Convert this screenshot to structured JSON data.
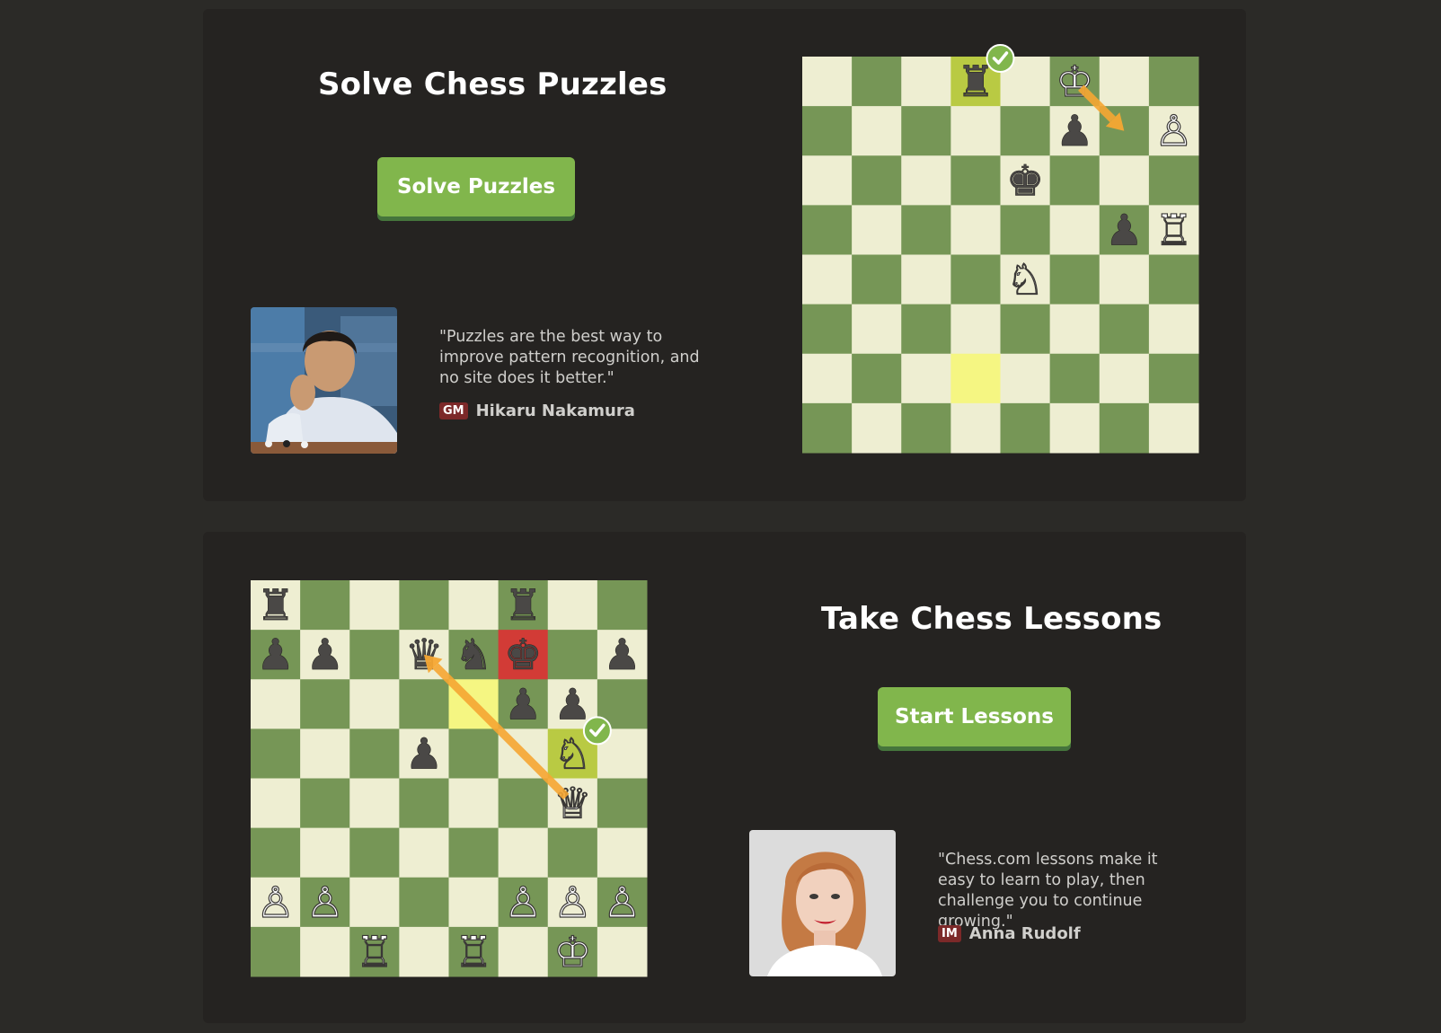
{
  "puzzles_section": {
    "title": "Solve Chess Puzzles",
    "button_label": "Solve Puzzles",
    "quote": "\"Puzzles are the best way to improve pattern recognition, and no site does it better.\"",
    "author_title": "GM",
    "author_name": "Hikaru Nakamura",
    "board": {
      "pieces": [
        {
          "square": "d8",
          "piece": "rook",
          "color": "black"
        },
        {
          "square": "f8",
          "piece": "king",
          "color": "white"
        },
        {
          "square": "f7",
          "piece": "pawn",
          "color": "black"
        },
        {
          "square": "h7",
          "piece": "pawn",
          "color": "white"
        },
        {
          "square": "e6",
          "piece": "king",
          "color": "black"
        },
        {
          "square": "g5",
          "piece": "pawn",
          "color": "black"
        },
        {
          "square": "h5",
          "piece": "rook",
          "color": "white"
        },
        {
          "square": "e4",
          "piece": "knight",
          "color": "white"
        }
      ],
      "highlights": [
        {
          "square": "d8",
          "color": "#b9ca43"
        },
        {
          "square": "d2",
          "color": "#f5f682"
        }
      ],
      "arrow": {
        "from": "f8",
        "to": "g7",
        "color": "#f6a733"
      },
      "check_mark_square": "d8"
    }
  },
  "lessons_section": {
    "title": "Take Chess Lessons",
    "button_label": "Start Lessons",
    "quote": "\"Chess.com lessons make it easy to learn to play, then challenge you to continue growing.\"",
    "author_title": "IM",
    "author_name": "Anna Rudolf",
    "board": {
      "pieces": [
        {
          "square": "a8",
          "piece": "rook",
          "color": "black"
        },
        {
          "square": "f8",
          "piece": "rook",
          "color": "black"
        },
        {
          "square": "a7",
          "piece": "pawn",
          "color": "black"
        },
        {
          "square": "b7",
          "piece": "pawn",
          "color": "black"
        },
        {
          "square": "d7",
          "piece": "queen",
          "color": "black"
        },
        {
          "square": "e7",
          "piece": "knight",
          "color": "black"
        },
        {
          "square": "f7",
          "piece": "king",
          "color": "black"
        },
        {
          "square": "h7",
          "piece": "pawn",
          "color": "black"
        },
        {
          "square": "f6",
          "piece": "pawn",
          "color": "black"
        },
        {
          "square": "g6",
          "piece": "pawn",
          "color": "black"
        },
        {
          "square": "d5",
          "piece": "pawn",
          "color": "black"
        },
        {
          "square": "g5",
          "piece": "knight",
          "color": "white"
        },
        {
          "square": "g4",
          "piece": "queen",
          "color": "white"
        },
        {
          "square": "a2",
          "piece": "pawn",
          "color": "white"
        },
        {
          "square": "b2",
          "piece": "pawn",
          "color": "white"
        },
        {
          "square": "f2",
          "piece": "pawn",
          "color": "white"
        },
        {
          "square": "g2",
          "piece": "pawn",
          "color": "white"
        },
        {
          "square": "h2",
          "piece": "pawn",
          "color": "white"
        },
        {
          "square": "c1",
          "piece": "rook",
          "color": "white"
        },
        {
          "square": "e1",
          "piece": "rook",
          "color": "white"
        },
        {
          "square": "g1",
          "piece": "king",
          "color": "white"
        }
      ],
      "highlights": [
        {
          "square": "f7",
          "color": "#d23b36"
        },
        {
          "square": "e6",
          "color": "#f5f682"
        },
        {
          "square": "g5",
          "color": "#b9ca43"
        }
      ],
      "arrow": {
        "from": "g4",
        "to": "d7",
        "color": "#f6a733"
      },
      "check_mark_square": "g5"
    }
  },
  "colors": {
    "page_background": "#2b2a27",
    "panel_background": "#252321",
    "light_square": "#eeeed2",
    "dark_square": "#769656",
    "button": "#81b64c",
    "button_shadow": "#45753c",
    "title_badge": "#7c2929"
  },
  "icons": [
    "check-icon",
    "chess-rook-icon",
    "chess-king-icon",
    "chess-pawn-icon",
    "chess-knight-icon",
    "chess-queen-icon"
  ]
}
